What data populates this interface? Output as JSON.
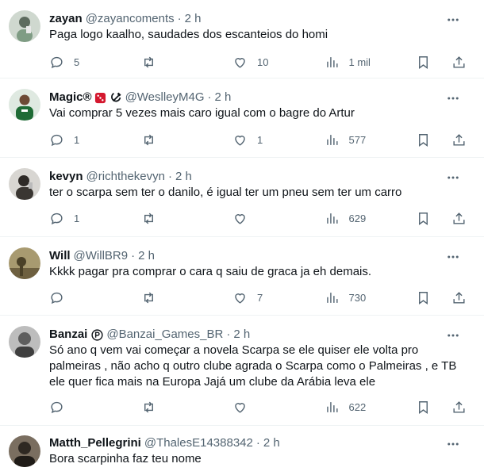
{
  "tweets": [
    {
      "name": "zayan",
      "handle": "@zayancoments",
      "time": "2 h",
      "text": "Paga logo kaalho, saudades dos escanteios do homi",
      "replies": "5",
      "retweets": "",
      "likes": "10",
      "views": "1 mil",
      "avatar_color": "#9fb3a4"
    },
    {
      "name": "Magic®",
      "badge_icons": [
        "dice-icon",
        "hammer-sickle-icon"
      ],
      "handle": "@WeslleyM4G",
      "time": "2 h",
      "text": "Vai comprar 5 vezes mais caro igual com o bagre do Artur",
      "replies": "1",
      "retweets": "",
      "likes": "1",
      "views": "577",
      "avatar_color": "#2f6b3a"
    },
    {
      "name": "kevyn",
      "handle": "@richthekevyn",
      "time": "2 h",
      "text": "ter o scarpa sem ter o danilo, é igual ter um pneu sem ter um carro",
      "replies": "1",
      "retweets": "",
      "likes": "",
      "views": "629",
      "avatar_color": "#c9c6c1"
    },
    {
      "name": "Will",
      "handle": "@WillBR9",
      "time": "2 h",
      "text": "Kkkk pagar pra comprar o cara q saiu de graca ja eh demais.",
      "replies": "",
      "retweets": "",
      "likes": "7",
      "views": "730",
      "avatar_color": "#8a7a55"
    },
    {
      "name": "Banzai",
      "badge_icons": [
        "circle-p-icon"
      ],
      "handle": "@Banzai_Games_BR",
      "time": "2 h",
      "text": "Só ano q vem  vai começar a novela Scarpa  se ele quiser ele volta pro palmeiras , não acho q outro clube  agrada o Scarpa como o Palmeiras , e TB ele quer fica mais na Europa Jajá um clube da Arábia leva ele",
      "replies": "",
      "retweets": "",
      "likes": "",
      "views": "622",
      "avatar_color": "#6b6b6b"
    },
    {
      "name": "Matth_Pellegrini",
      "handle": "@ThalesE14388342",
      "time": "2 h",
      "text": "Bora scarpinha faz teu nome",
      "replies": "",
      "retweets": "",
      "likes": "",
      "views": "",
      "avatar_color": "#4a4238"
    }
  ]
}
